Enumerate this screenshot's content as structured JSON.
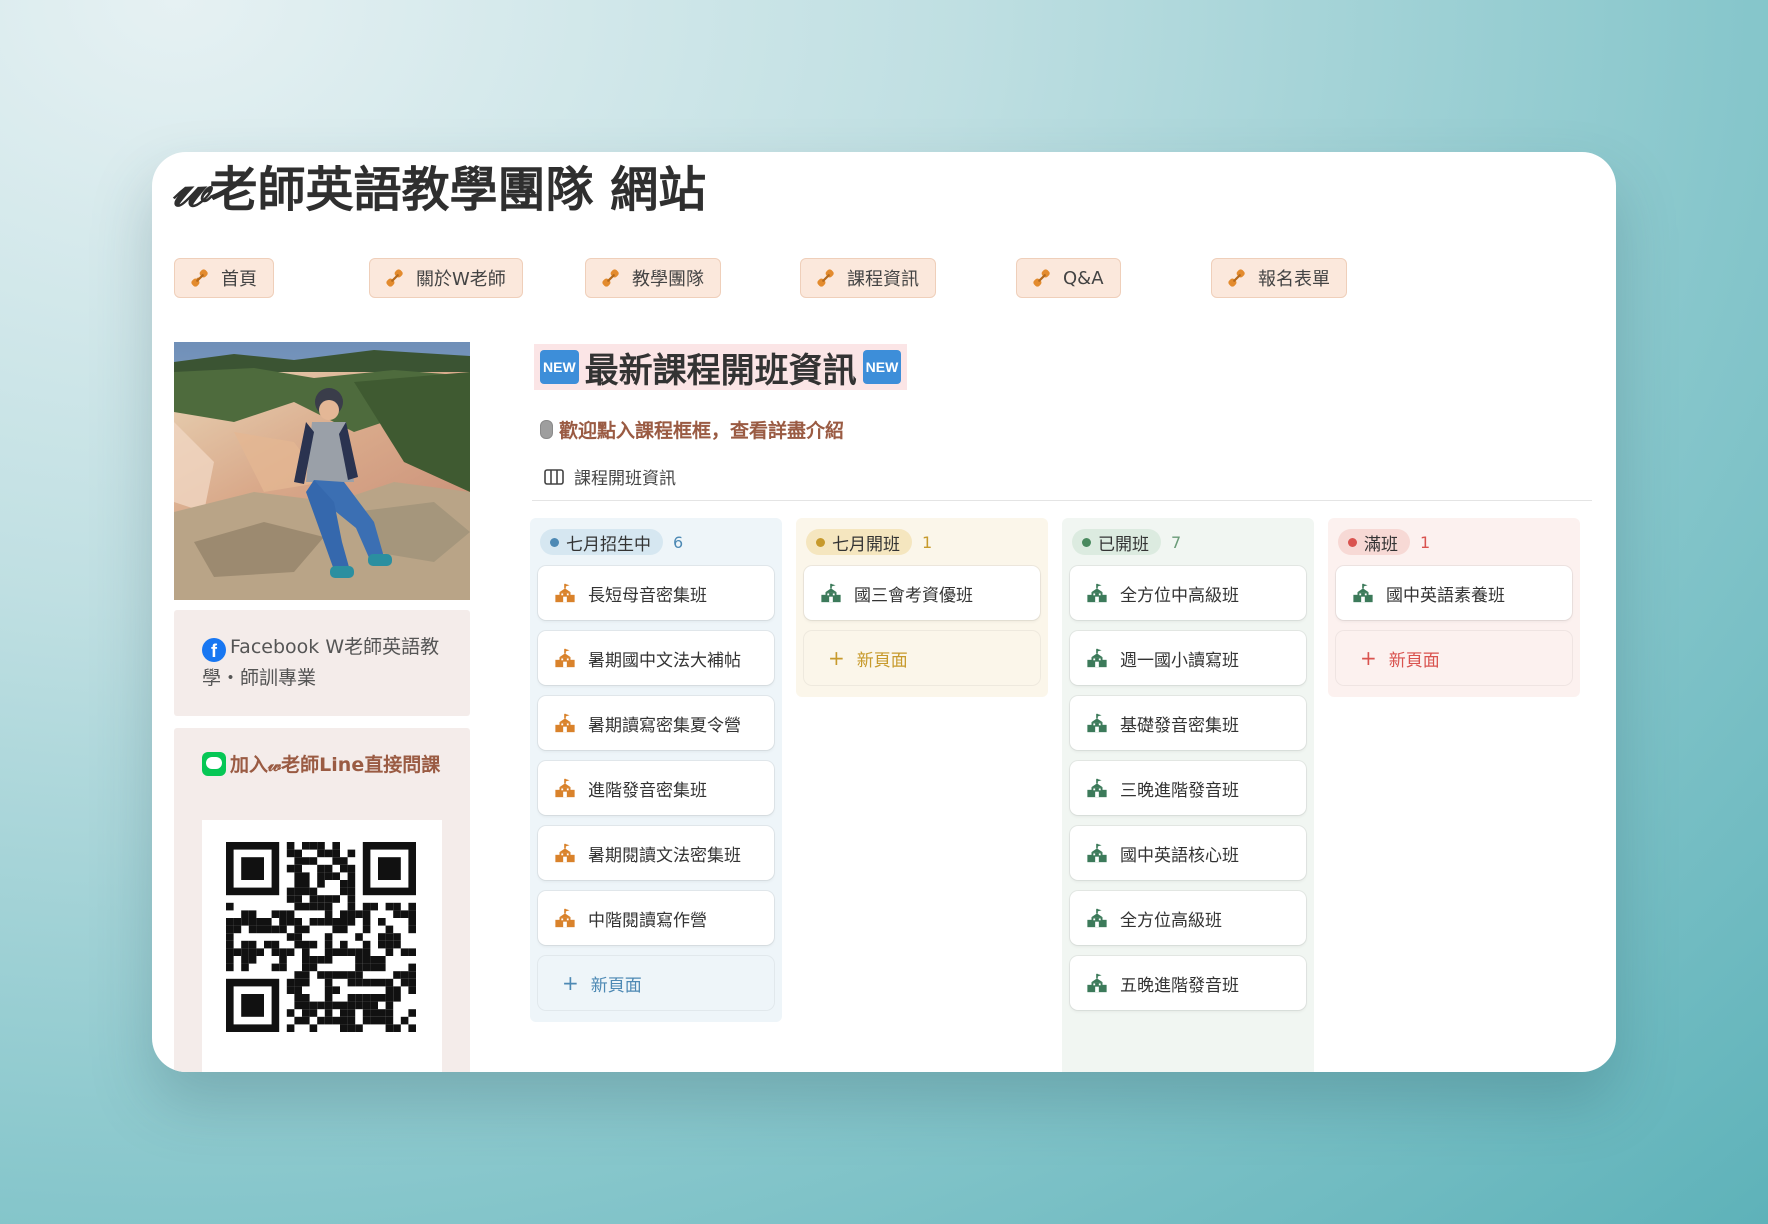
{
  "site": {
    "title_mark": "𝓌",
    "title": "老師英語教學團隊 網站"
  },
  "nav": [
    {
      "label": "首頁"
    },
    {
      "label": "關於W老師"
    },
    {
      "label": "教學團隊"
    },
    {
      "label": "課程資訊"
    },
    {
      "label": "Q&A"
    },
    {
      "label": "報名表單"
    }
  ],
  "sidebar": {
    "facebook_text": "Facebook W老師英語教學・師訓專業",
    "line_text": "加入𝓌老師Line直接問課"
  },
  "main": {
    "heading_badge": "NEW",
    "heading": "最新課程開班資訊",
    "welcome": "歡迎點入課程框框，查看詳盡介紹",
    "view_tab": "課程開班資訊"
  },
  "board": {
    "new_page_label": "新頁面",
    "columns": [
      {
        "name": "七月招生中",
        "count": "6",
        "colors": {
          "bg": "#eef5f9",
          "tag": "#d6e7f1",
          "dot": "#4d89b4",
          "count": "#4d89b4",
          "icon": "#d9822b",
          "newpage": "#4d89b4"
        },
        "items": [
          "長短母音密集班",
          "暑期國中文法大補帖",
          "暑期讀寫密集夏令營",
          "進階發音密集班",
          "暑期閱讀文法密集班",
          "中階閱讀寫作營"
        ]
      },
      {
        "name": "七月開班",
        "count": "1",
        "colors": {
          "bg": "#fbf6ea",
          "tag": "#f5e6bf",
          "dot": "#c79a2c",
          "count": "#c79a2c",
          "icon": "#3c7a5a",
          "newpage": "#c79a2c"
        },
        "items": [
          "國三會考資優班"
        ]
      },
      {
        "name": "已開班",
        "count": "7",
        "colors": {
          "bg": "#f1f6f2",
          "tag": "#dcebe0",
          "dot": "#4a8a5f",
          "count": "#6a9b78",
          "icon": "#3c7a5a",
          "newpage": "#4a8a5f"
        },
        "items": [
          "全方位中高級班",
          "週一國小讀寫班",
          "基礎發音密集班",
          "三晚進階發音班",
          "國中英語核心班",
          "全方位高級班",
          "五晚進階發音班"
        ]
      },
      {
        "name": "滿班",
        "count": "1",
        "colors": {
          "bg": "#fcf1ef",
          "tag": "#f7d9d5",
          "dot": "#d9534f",
          "count": "#d9534f",
          "icon": "#3c7a5a",
          "newpage": "#d9534f"
        },
        "items": [
          "國中英語素養班"
        ]
      }
    ]
  }
}
